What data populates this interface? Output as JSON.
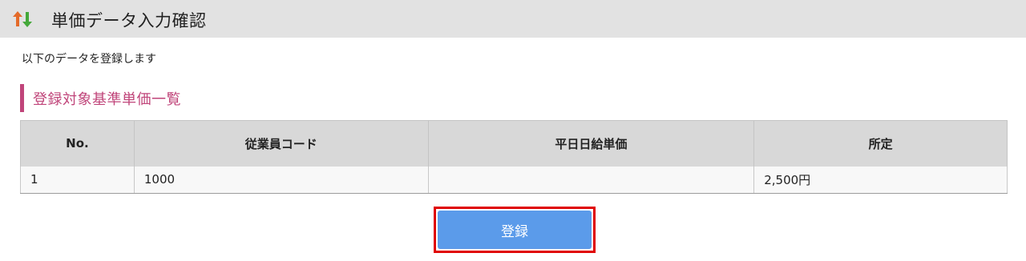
{
  "header": {
    "title": "単価データ入力確認",
    "icon": "sort-arrows-icon",
    "icon_colors": {
      "up": "#e46b2a",
      "down": "#44a83a"
    }
  },
  "intro_text": "以下のデータを登録します",
  "section": {
    "title": "登録対象基準単価一覧",
    "accent_color": "#c0457a"
  },
  "table": {
    "columns": [
      "No.",
      "従業員コード",
      "平日日給単価",
      "所定"
    ],
    "rows": [
      {
        "no": "1",
        "employee_code": "1000",
        "weekday_daily_rate": "",
        "scheduled": "2,500円"
      }
    ]
  },
  "actions": {
    "register_label": "登録",
    "button_color": "#5b9bea",
    "highlight_color": "#e00000"
  }
}
